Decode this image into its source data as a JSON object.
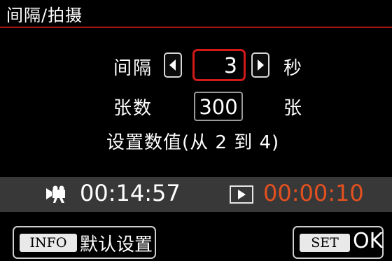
{
  "title": "间隔/拍摄",
  "interval": {
    "label": "间隔",
    "value": "3",
    "unit": "秒"
  },
  "shots": {
    "label": "张数",
    "value": "300",
    "unit": "张"
  },
  "hint": "设置数值(从 2 到 4)",
  "status": {
    "movie_time": "00:14:57",
    "playback_time": "00:00:10"
  },
  "buttons": {
    "info_key": "INFO",
    "info_label": "默认设置",
    "set_key": "SET",
    "set_label": "OK"
  },
  "colors": {
    "accent_red": "#d11a1a",
    "playback_orange": "#e35020",
    "bar_gray": "#383838"
  },
  "icons": {
    "decrease": "left-triangle-icon",
    "increase": "right-triangle-icon",
    "movie": "movie-camera-icon",
    "playback": "play-icon"
  }
}
